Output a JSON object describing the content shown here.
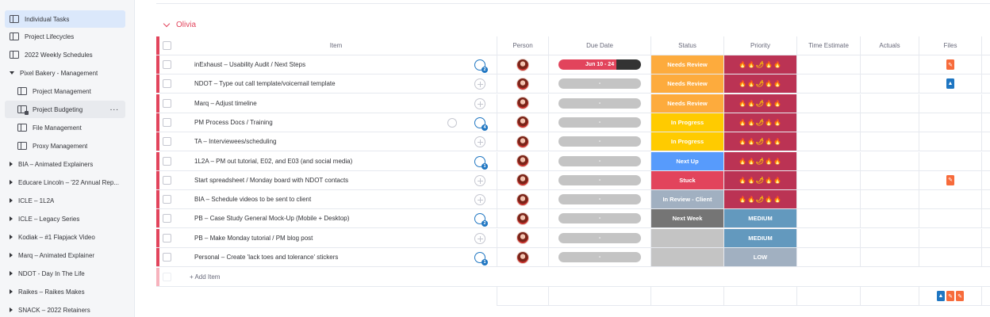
{
  "sidebar": {
    "items": [
      {
        "label": "Individual Tasks",
        "kind": "board",
        "active": true
      },
      {
        "label": "Project Lifecycles",
        "kind": "board"
      },
      {
        "label": "2022 Weekly Schedules",
        "kind": "board"
      },
      {
        "label": "Pixel Bakery - Management",
        "kind": "folder-open"
      },
      {
        "label": "Project Management",
        "kind": "board",
        "indent": true
      },
      {
        "label": "Project Budgeting",
        "kind": "board-locked",
        "indent": true,
        "menu": "..."
      },
      {
        "label": "File Management",
        "kind": "board",
        "indent": true
      },
      {
        "label": "Proxy Management",
        "kind": "board",
        "indent": true
      },
      {
        "label": "BIA – Animated Explainers",
        "kind": "folder"
      },
      {
        "label": "Educare Lincoln – '22 Annual Rep...",
        "kind": "folder"
      },
      {
        "label": "ICLE – 1L2A",
        "kind": "folder"
      },
      {
        "label": "ICLE – Legacy Series",
        "kind": "folder"
      },
      {
        "label": "Kodiak – #1 Flapjack Video",
        "kind": "folder"
      },
      {
        "label": "Marq – Animated Explainer",
        "kind": "folder"
      },
      {
        "label": "NDOT - Day In The Life",
        "kind": "folder"
      },
      {
        "label": "Raikes – Raikes Makes",
        "kind": "folder"
      },
      {
        "label": "SNACK – 2022 Retainers",
        "kind": "folder"
      }
    ]
  },
  "group": {
    "title": "Olivia",
    "color": "#e2445c"
  },
  "columns": {
    "item": "Item",
    "person": "Person",
    "due": "Due Date",
    "status": "Status",
    "priority": "Priority",
    "estimate": "Time Estimate",
    "actuals": "Actuals",
    "files": "Files"
  },
  "rows": [
    {
      "name": "inExhaust – Usability Audit / Next Steps",
      "updates": "2",
      "due": "Jun 10 - 24",
      "status": "Needs Review",
      "status_color": "#fdab3d",
      "priority": "flames",
      "files": [
        "orange"
      ]
    },
    {
      "name": "NDOT – Type out call template/voicemail template",
      "updates": "",
      "due": "-",
      "status": "Needs Review",
      "status_color": "#fdab3d",
      "priority": "flames",
      "files": [
        "blue"
      ]
    },
    {
      "name": "Marq – Adjust timeline",
      "updates": "",
      "due": "-",
      "status": "Needs Review",
      "status_color": "#fdab3d",
      "priority": "flames",
      "files": []
    },
    {
      "name": "PM Process Docs / Training",
      "updates": "4",
      "progress": true,
      "due": "-",
      "status": "In Progress",
      "status_color": "#ffcb00",
      "priority": "flames",
      "files": []
    },
    {
      "name": "TA – Interviewees/scheduling",
      "updates": "",
      "due": "-",
      "status": "In Progress",
      "status_color": "#ffcb00",
      "priority": "flames",
      "files": []
    },
    {
      "name": "1L2A – PM out tutorial, E02, and E03 (and social media)",
      "updates": "1",
      "due": "-",
      "status": "Next Up",
      "status_color": "#579bfc",
      "priority": "flames",
      "files": []
    },
    {
      "name": "Start spreadsheet / Monday board with NDOT contacts",
      "updates": "",
      "due": "-",
      "status": "Stuck",
      "status_color": "#e2445c",
      "priority": "flames",
      "files": [
        "orange"
      ]
    },
    {
      "name": "BIA – Schedule videos to be sent to client",
      "updates": "",
      "due": "-",
      "status": "In Review - Client",
      "status_color": "#a1b0c1",
      "priority": "flames",
      "files": []
    },
    {
      "name": "PB – Case Study General Mock-Up (Mobile + Desktop)",
      "updates": "2",
      "due": "-",
      "status": "Next Week",
      "status_color": "#757575",
      "priority": "MEDIUM",
      "priority_color": "#6399be",
      "files": []
    },
    {
      "name": "PB – Make Monday tutorial / PM blog post",
      "updates": "",
      "due": "-",
      "status": "",
      "status_color": "#c4c4c4",
      "priority": "MEDIUM",
      "priority_color": "#6399be",
      "files": []
    },
    {
      "name": "Personal – Create 'lack toes and tolerance' stickers",
      "updates": "1",
      "due": "-",
      "status": "",
      "status_color": "#c4c4c4",
      "priority": "LOW",
      "priority_color": "#a1b0c1",
      "files": []
    }
  ],
  "flames_text": "🔥🔥🌶🔥🔥",
  "flames_color": "#bb3354",
  "add_item": "+ Add Item",
  "summary_files": [
    "blue",
    "orange",
    "orange"
  ],
  "icons": {
    "file": "file-icon",
    "update": "update-bubble-icon"
  }
}
